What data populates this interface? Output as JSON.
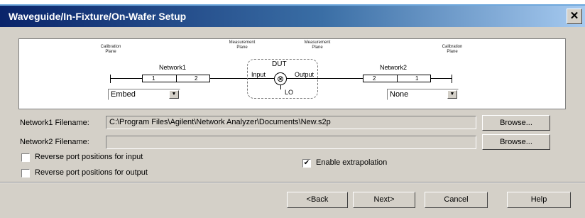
{
  "window": {
    "title": "Waveguide/In-Fixture/On-Wafer Setup",
    "close_glyph": "✕"
  },
  "diagram": {
    "left_plane": "Calibration\nPlane",
    "left_meas_plane": "Measurement\nPlane",
    "right_meas_plane": "Measurement\nPlane",
    "right_plane": "Calibration\nPlane",
    "network1_label": "Network1",
    "network2_label": "Network2",
    "network1_port1": "1",
    "network1_port2": "2",
    "network2_port2": "2",
    "network2_port1": "1",
    "dut_label": "DUT",
    "input_label": "Input",
    "output_label": "Output",
    "lo_label": "LO",
    "mixer_glyph": "⊗",
    "network1_select": "Embed",
    "network2_select": "None"
  },
  "fields": {
    "network1_label": "Network1 Filename:",
    "network1_value": "C:\\Program Files\\Agilent\\Network Analyzer\\Documents\\New.s2p",
    "network2_label": "Network2 Filename:",
    "network2_value": "",
    "browse1": "Browse...",
    "browse2": "Browse..."
  },
  "options": {
    "reverse_input": "Reverse port positions for input",
    "reverse_output": "Reverse port positions for output",
    "extrapolation": "Enable extrapolation",
    "extrapolation_check": "✔"
  },
  "buttons": {
    "back": "<Back",
    "next": "Next>",
    "cancel": "Cancel",
    "help": "Help"
  }
}
